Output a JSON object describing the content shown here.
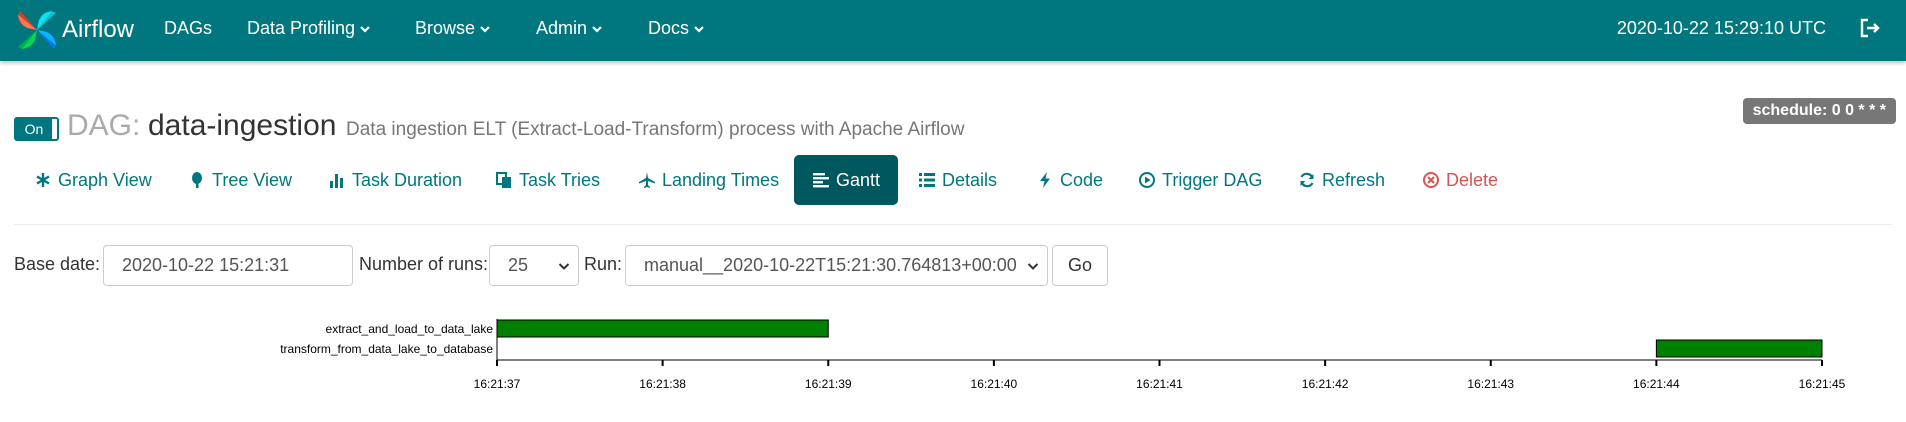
{
  "navbar": {
    "brand": "Airflow",
    "items": [
      {
        "label": "DAGs",
        "has_caret": false
      },
      {
        "label": "Data Profiling",
        "has_caret": true
      },
      {
        "label": "Browse",
        "has_caret": true
      },
      {
        "label": "Admin",
        "has_caret": true
      },
      {
        "label": "Docs",
        "has_caret": true
      }
    ],
    "time": "2020-10-22 15:29:10 UTC",
    "logout_icon": "sign-out-icon"
  },
  "header": {
    "toggle_label": "On",
    "dag_label": "DAG:",
    "dag_id": "data-ingestion",
    "description": "Data ingestion ELT (Extract-Load-Transform) process with Apache Airflow",
    "schedule": "schedule: 0 0 * * *"
  },
  "tabs": [
    {
      "label": "Graph View",
      "icon": "asterisk-icon"
    },
    {
      "label": "Tree View",
      "icon": "tree-icon"
    },
    {
      "label": "Task Duration",
      "icon": "bar-chart-icon"
    },
    {
      "label": "Task Tries",
      "icon": "duplicate-icon"
    },
    {
      "label": "Landing Times",
      "icon": "plane-icon"
    },
    {
      "label": "Gantt",
      "icon": "align-left-icon",
      "active": true
    },
    {
      "label": "Details",
      "icon": "list-icon"
    },
    {
      "label": "Code",
      "icon": "flash-icon"
    },
    {
      "label": "Trigger DAG",
      "icon": "play-circle-icon"
    },
    {
      "label": "Refresh",
      "icon": "refresh-icon"
    },
    {
      "label": "Delete",
      "icon": "remove-circle-icon"
    }
  ],
  "form": {
    "base_date_label": "Base date:",
    "base_date_value": "2020-10-22 15:21:31",
    "num_runs_label": "Number of runs:",
    "num_runs_value": "25",
    "run_label": "Run:",
    "run_value": "manual__2020-10-22T15:21:30.764813+00:00",
    "go_label": "Go"
  },
  "colors": {
    "navbar": "#00777f",
    "accent": "#00777f",
    "active_tab": "#00585f",
    "bar_success": "#008000"
  },
  "chart_data": {
    "type": "gantt",
    "tasks": [
      {
        "name": "extract_and_load_to_data_lake",
        "start": "16:21:37",
        "end": "16:21:39"
      },
      {
        "name": "transform_from_data_lake_to_database",
        "start": "16:21:44",
        "end": "16:21:45"
      }
    ],
    "x_ticks": [
      "16:21:37",
      "16:21:38",
      "16:21:39",
      "16:21:40",
      "16:21:41",
      "16:21:42",
      "16:21:43",
      "16:21:44",
      "16:21:45"
    ],
    "x_range": [
      "16:21:37",
      "16:21:45"
    ],
    "grid": false
  }
}
